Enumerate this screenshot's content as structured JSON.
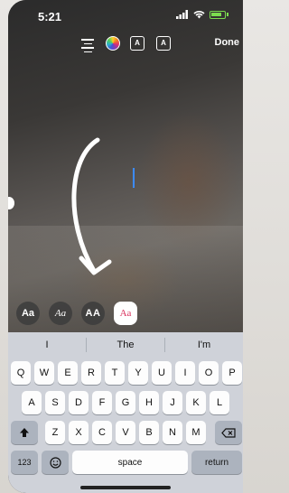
{
  "status_bar": {
    "time": "5:21"
  },
  "toolbar": {
    "effect_a_label": "A",
    "effect_b_label": "A",
    "done_label": "Done"
  },
  "font_options": {
    "classic": "Aa",
    "serif": "Aa",
    "strong": "AA",
    "selected": "Aa"
  },
  "keyboard": {
    "predictions": [
      "I",
      "The",
      "I'm"
    ],
    "row1": [
      "Q",
      "W",
      "E",
      "R",
      "T",
      "Y",
      "U",
      "I",
      "O",
      "P"
    ],
    "row2": [
      "A",
      "S",
      "D",
      "F",
      "G",
      "H",
      "J",
      "K",
      "L"
    ],
    "row3": [
      "Z",
      "X",
      "C",
      "V",
      "B",
      "N",
      "M"
    ],
    "numbers_key": "123",
    "space_key": "space",
    "return_key": "return"
  },
  "colors": {
    "battery": "#7cdc4f",
    "cursor": "#3c8bff",
    "keyboard_bg": "#cfd2d9",
    "selected_font_accent": "#d9305c"
  }
}
